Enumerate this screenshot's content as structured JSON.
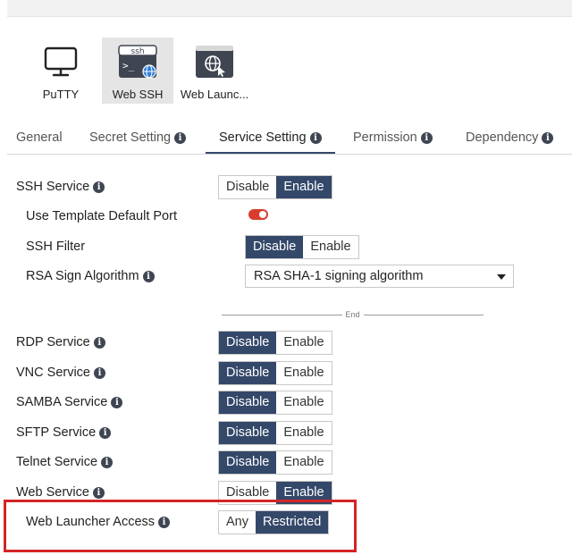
{
  "launchers": [
    {
      "label": "PuTTY",
      "icon": "monitor-icon"
    },
    {
      "label": "Web SSH",
      "icon": "terminal-globe-icon",
      "icon_text": "ssh"
    },
    {
      "label": "Web Launc...",
      "icon": "globe-cursor-icon"
    }
  ],
  "tabs": [
    {
      "label": "General",
      "info": false
    },
    {
      "label": "Secret Setting",
      "info": true
    },
    {
      "label": "Service Setting",
      "info": true,
      "active": true
    },
    {
      "label": "Permission",
      "info": true
    },
    {
      "label": "Dependency",
      "info": true
    }
  ],
  "segment_labels": {
    "disable": "Disable",
    "enable": "Enable",
    "any": "Any",
    "restricted": "Restricted"
  },
  "ssh": {
    "service_label": "SSH Service",
    "service_value": "Enable",
    "template_port_label": "Use Template Default Port",
    "template_port_enabled": true,
    "filter_label": "SSH Filter",
    "filter_value": "Disable",
    "rsa_label": "RSA Sign Algorithm",
    "rsa_value": "RSA SHA-1 signing algorithm"
  },
  "divider_text": "End",
  "services": [
    {
      "label": "RDP Service",
      "value": "Disable"
    },
    {
      "label": "VNC Service",
      "value": "Disable"
    },
    {
      "label": "SAMBA Service",
      "value": "Disable"
    },
    {
      "label": "SFTP Service",
      "value": "Disable"
    },
    {
      "label": "Telnet Service",
      "value": "Disable"
    },
    {
      "label": "Web Service",
      "value": "Enable"
    }
  ],
  "web_launcher": {
    "label": "Web Launcher Access",
    "value": "Restricted"
  },
  "colors": {
    "accent": "#34486a",
    "toggle_on": "#d93c2e",
    "highlight": "#d42427"
  }
}
